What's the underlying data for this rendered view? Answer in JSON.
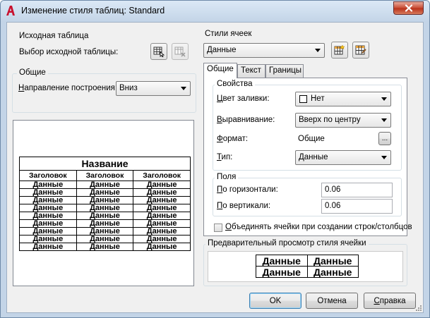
{
  "window": {
    "title": "Изменение стиля таблиц: Standard"
  },
  "source_table": {
    "group_title": "Исходная таблица",
    "select_label": "Выбор исходной таблицы:"
  },
  "general": {
    "group_title": "Общие",
    "direction_label_u": "Н",
    "direction_label_rest": "аправление построения:",
    "direction_value": "Вниз"
  },
  "cell_styles": {
    "group_title": "Стили ячеек",
    "value": "Данные"
  },
  "tabs": [
    {
      "label": "Общие"
    },
    {
      "label": "Текст"
    },
    {
      "label": "Границы"
    }
  ],
  "properties": {
    "group_title": "Свойства",
    "fill_label_u": "Ц",
    "fill_label_rest": "вет заливки:",
    "fill_value": "Нет",
    "align_label_u": "В",
    "align_label_rest": "ыравнивание:",
    "align_value": "Вверх по центру",
    "format_label_u": "Ф",
    "format_label_rest": "ормат:",
    "format_value": "Общие",
    "format_button": "...",
    "type_label_u": "Т",
    "type_label_rest": "ип:",
    "type_value": "Данные"
  },
  "margins": {
    "group_title": "Поля",
    "horizontal_label_u": "П",
    "horizontal_label_rest": "о горизонтали:",
    "horizontal_value": "0.06",
    "vertical_label_u": "П",
    "vertical_label_rest": "о вертикали:",
    "vertical_value": "0.06"
  },
  "merge_checkbox": {
    "label_u": "О",
    "label_rest": "бъединять ячейки при создании строк/столбцов",
    "checked": false
  },
  "cell_preview": {
    "group_title": "Предварительный просмотр стиля ячейки",
    "cells": [
      "Данные",
      "Данные",
      "Данные",
      "Данные"
    ]
  },
  "table_preview": {
    "title": "Название",
    "headers": [
      "Заголовок",
      "Заголовок",
      "Заголовок"
    ],
    "row_value": "Данные",
    "row_count": 9
  },
  "buttons": {
    "ok": "OK",
    "cancel": "Отмена",
    "help_u": "С",
    "help_rest": "правка"
  },
  "colors": {
    "title_accent": "#c3d4e7",
    "close_button": "#c74b33",
    "app_icon": "#c8102e"
  }
}
